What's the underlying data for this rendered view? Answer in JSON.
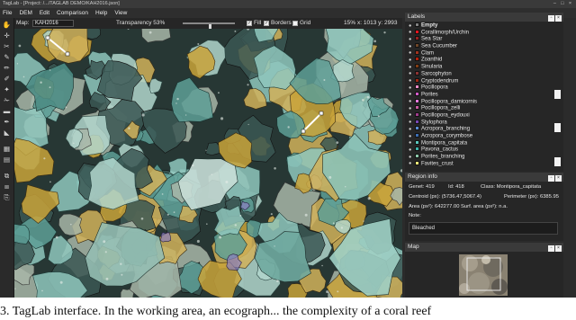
{
  "window": {
    "title": "TagLab - [Project: /.../TAGLAB DEMO/KAH2016.json]",
    "controls": [
      "–",
      "□",
      "×"
    ]
  },
  "menu": [
    "File",
    "DEM",
    "Edit",
    "Comparison",
    "Help",
    "View"
  ],
  "tools": [
    {
      "icon": "move-icon",
      "glyph": "✋"
    },
    {
      "icon": "crosshair-icon",
      "glyph": "✛"
    },
    {
      "icon": "scissors-icon",
      "glyph": "✂"
    },
    {
      "icon": "pen-icon",
      "glyph": "✎"
    },
    {
      "icon": "pencil-icon",
      "glyph": "✏"
    },
    {
      "icon": "brush-icon",
      "glyph": "✐"
    },
    {
      "icon": "wand-icon",
      "glyph": "✦"
    },
    {
      "icon": "cut-icon",
      "glyph": "✁"
    },
    {
      "icon": "ruler-icon",
      "glyph": "▬"
    },
    {
      "icon": "eyedropper-icon",
      "glyph": "✒"
    },
    {
      "icon": "bucket-icon",
      "glyph": "◣"
    },
    {
      "icon": "grid-icon",
      "glyph": "▦"
    },
    {
      "icon": "calendar-icon",
      "glyph": "▤"
    },
    {
      "icon": "layers-icon",
      "glyph": "⧉"
    },
    {
      "icon": "link-icon",
      "glyph": "⧈"
    },
    {
      "icon": "export-icon",
      "glyph": "⎘"
    }
  ],
  "mapbar": {
    "map_label": "Map:",
    "map_value": "KAH2016",
    "transparency_label": "Transparency 53%",
    "transparency": 0.53,
    "fill_label": "Fill",
    "borders_label": "Borders",
    "grid_label": "Grid",
    "fill_checked": true,
    "borders_checked": true,
    "grid_checked": false,
    "zoom": "15%",
    "coords": "x: 1013 y: 2993"
  },
  "labels_panel": {
    "title": "Labels",
    "items": [
      {
        "name": "Empty",
        "color": "#808080"
      },
      {
        "name": "Corallimorph/Urchin",
        "color": "#e8141e"
      },
      {
        "name": "Sea Star",
        "color": "#962020"
      },
      {
        "name": "Sea Cucumber",
        "color": "#6e4628"
      },
      {
        "name": "Clam",
        "color": "#a0321e"
      },
      {
        "name": "Zoanthid",
        "color": "#b41e0a"
      },
      {
        "name": "Sinularia",
        "color": "#823c14"
      },
      {
        "name": "Sarcophyton",
        "color": "#8c3232"
      },
      {
        "name": "Cryptodendrum",
        "color": "#a02814"
      },
      {
        "name": "Pocillopora",
        "color": "#f08cc8"
      },
      {
        "name": "Porites",
        "color": "#d25ac8"
      },
      {
        "name": "Pocillopora_damicornis",
        "color": "#e678dc"
      },
      {
        "name": "Pocillopora_zelli",
        "color": "#c85aa0"
      },
      {
        "name": "Pocillopora_eydouxi",
        "color": "#a03c8c"
      },
      {
        "name": "Stylophora",
        "color": "#7846b4"
      },
      {
        "name": "Acropora_branching",
        "color": "#5a8cd2"
      },
      {
        "name": "Acropora_corymbose",
        "color": "#3c6eb4"
      },
      {
        "name": "Montipora_capitata",
        "color": "#5ac8be"
      },
      {
        "name": "Pavona_cactus",
        "color": "#3cb4aa"
      },
      {
        "name": "Porites_branching",
        "color": "#8cc8aa"
      },
      {
        "name": "Favites_crust",
        "color": "#f0e678"
      }
    ]
  },
  "region_info": {
    "title": "Region info",
    "genet_label": "Genet:",
    "genet": "419",
    "id_label": "Id:",
    "id": "418",
    "class_label": "Class:",
    "class": "Montipora_capitata",
    "centroid_label": "Centroid (px):",
    "centroid": "(5736.47,5067.4)",
    "perimeter_label": "Perimeter (px):",
    "perimeter": "6385.95",
    "area_label": "Area (px²):",
    "area": "642277.00",
    "surf_area_label": "Surf. area (px²):",
    "surf_area": "n.a.",
    "note_label": "Note:",
    "note": "Bleached"
  },
  "map_panel": {
    "title": "Map"
  },
  "caption": "3.  TagLab interface. In the working area, an ecograph... the complexity of a coral reef"
}
